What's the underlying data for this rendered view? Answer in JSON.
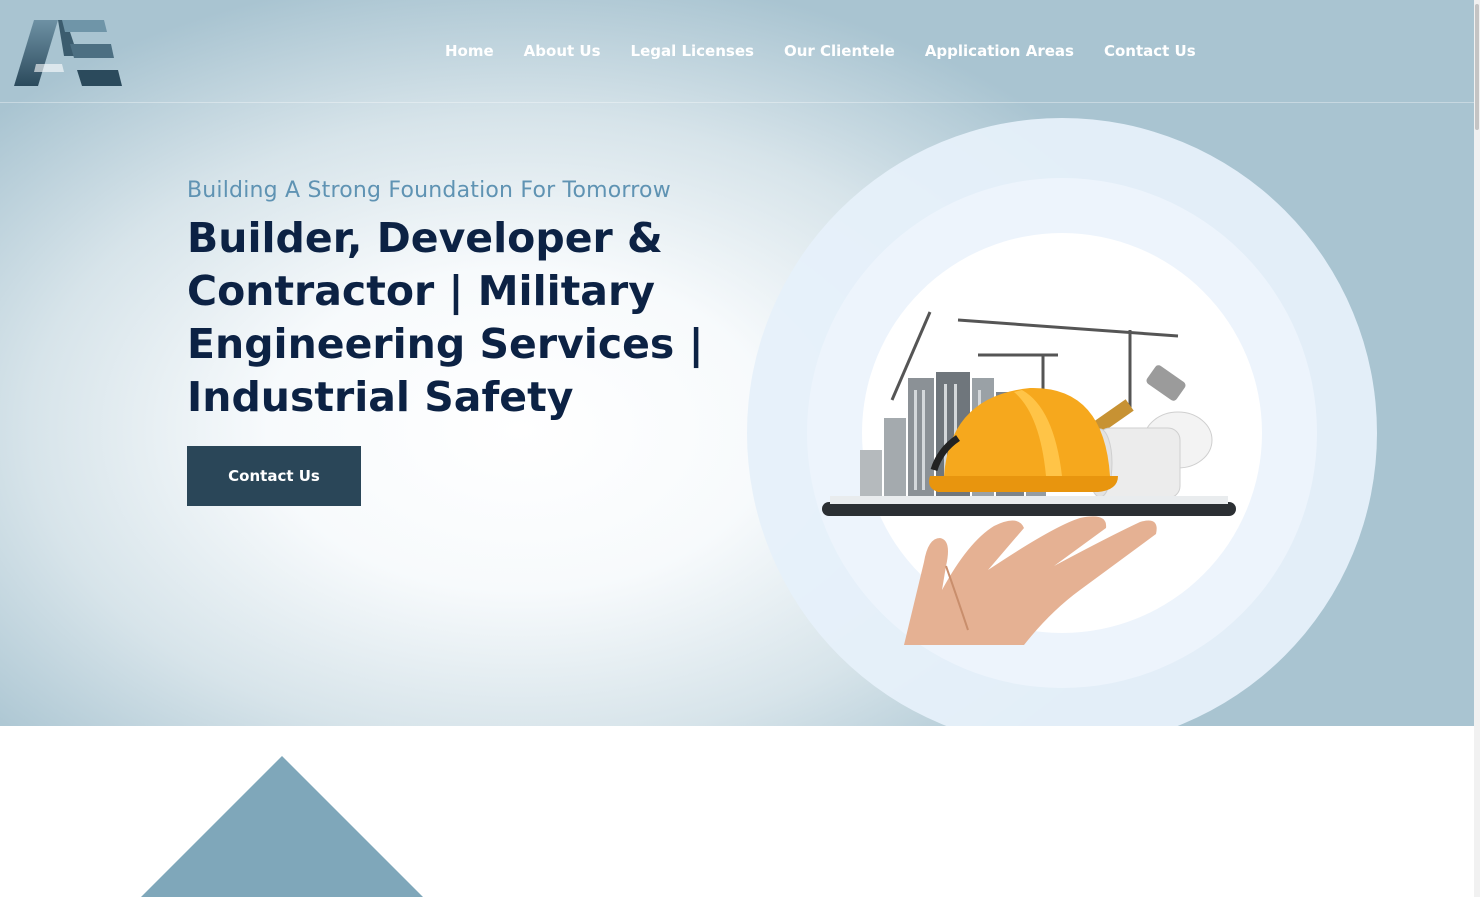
{
  "nav": {
    "items": [
      {
        "label": "Home"
      },
      {
        "label": "About Us"
      },
      {
        "label": "Legal Licenses"
      },
      {
        "label": "Our Clientele"
      },
      {
        "label": "Application Areas"
      },
      {
        "label": "Contact Us"
      }
    ]
  },
  "hero": {
    "tagline": "Building A Strong Foundation For Tomorrow",
    "headline": "Builder, Developer & Contractor | Military Engineering Services | Industrial Safety",
    "cta_label": "Contact Us",
    "illustration_icon": "construction-helmet-on-tablet-icon"
  },
  "colors": {
    "navy_text": "#0c2244",
    "tagline_blue": "#5f93b3",
    "button_bg": "#2a4658",
    "triangle_blue": "#7fa7ba",
    "helmet_yellow": "#f6a81d"
  }
}
